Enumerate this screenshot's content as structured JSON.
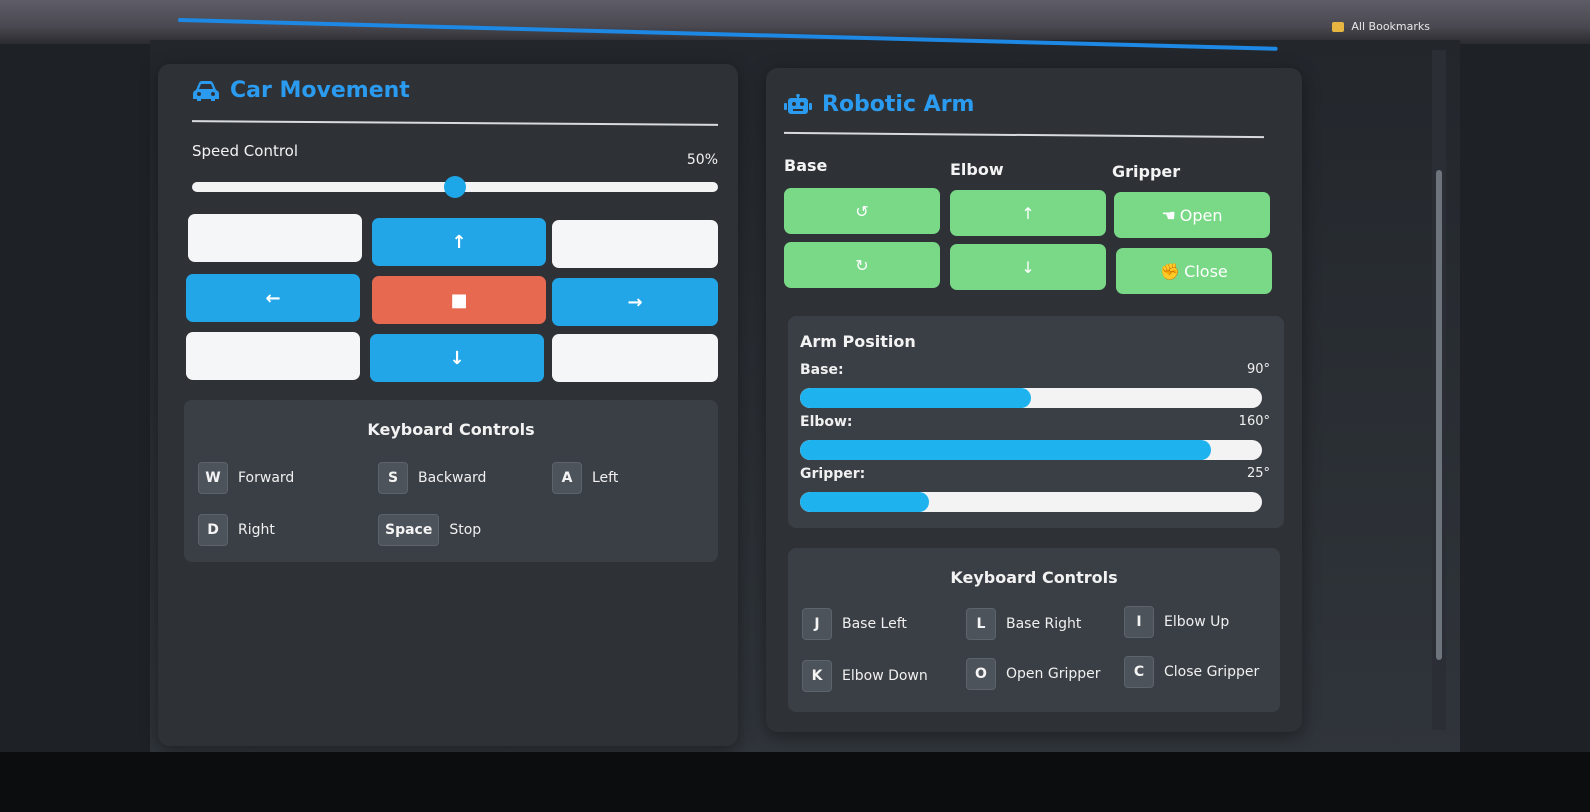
{
  "browser": {
    "bookmarks_label": "All Bookmarks"
  },
  "car": {
    "title": "Car Movement",
    "title_icon": "car-icon",
    "speed_label": "Speed Control",
    "speed_value": "50%",
    "speed_fraction": 0.5,
    "buttons": {
      "up": "↑",
      "left": "←",
      "stop": "■",
      "right": "→",
      "down": "↓"
    },
    "keyboard": {
      "title": "Keyboard Controls",
      "items": [
        {
          "key": "W",
          "action": "Forward"
        },
        {
          "key": "S",
          "action": "Backward"
        },
        {
          "key": "A",
          "action": "Left"
        },
        {
          "key": "D",
          "action": "Right"
        },
        {
          "key": "Space",
          "action": "Stop"
        }
      ]
    }
  },
  "arm": {
    "title": "Robotic Arm",
    "title_icon": "robot-icon",
    "columns": [
      "Base",
      "Elbow",
      "Gripper"
    ],
    "buttons": {
      "base_ccw": "↺",
      "base_cw": "↻",
      "elbow_up": "↑",
      "elbow_down": "↓",
      "gripper_open": "Open",
      "gripper_close": "Close"
    },
    "position": {
      "title": "Arm Position",
      "rows": [
        {
          "label": "Base:",
          "value": "90°",
          "fraction": 0.5
        },
        {
          "label": "Elbow:",
          "value": "160°",
          "fraction": 0.89
        },
        {
          "label": "Gripper:",
          "value": "25°",
          "fraction": 0.28
        }
      ]
    },
    "keyboard": {
      "title": "Keyboard Controls",
      "items": [
        {
          "key": "J",
          "action": "Base Left"
        },
        {
          "key": "L",
          "action": "Base Right"
        },
        {
          "key": "I",
          "action": "Elbow Up"
        },
        {
          "key": "K",
          "action": "Elbow Down"
        },
        {
          "key": "O",
          "action": "Open Gripper"
        },
        {
          "key": "C",
          "action": "Close Gripper"
        }
      ]
    }
  },
  "colors": {
    "accent": "#2b9bf0",
    "dpad_blue": "#22a6e8",
    "stop_red": "#e76a50",
    "arm_green": "#79d987",
    "bar_fill": "#1eb2ee"
  }
}
